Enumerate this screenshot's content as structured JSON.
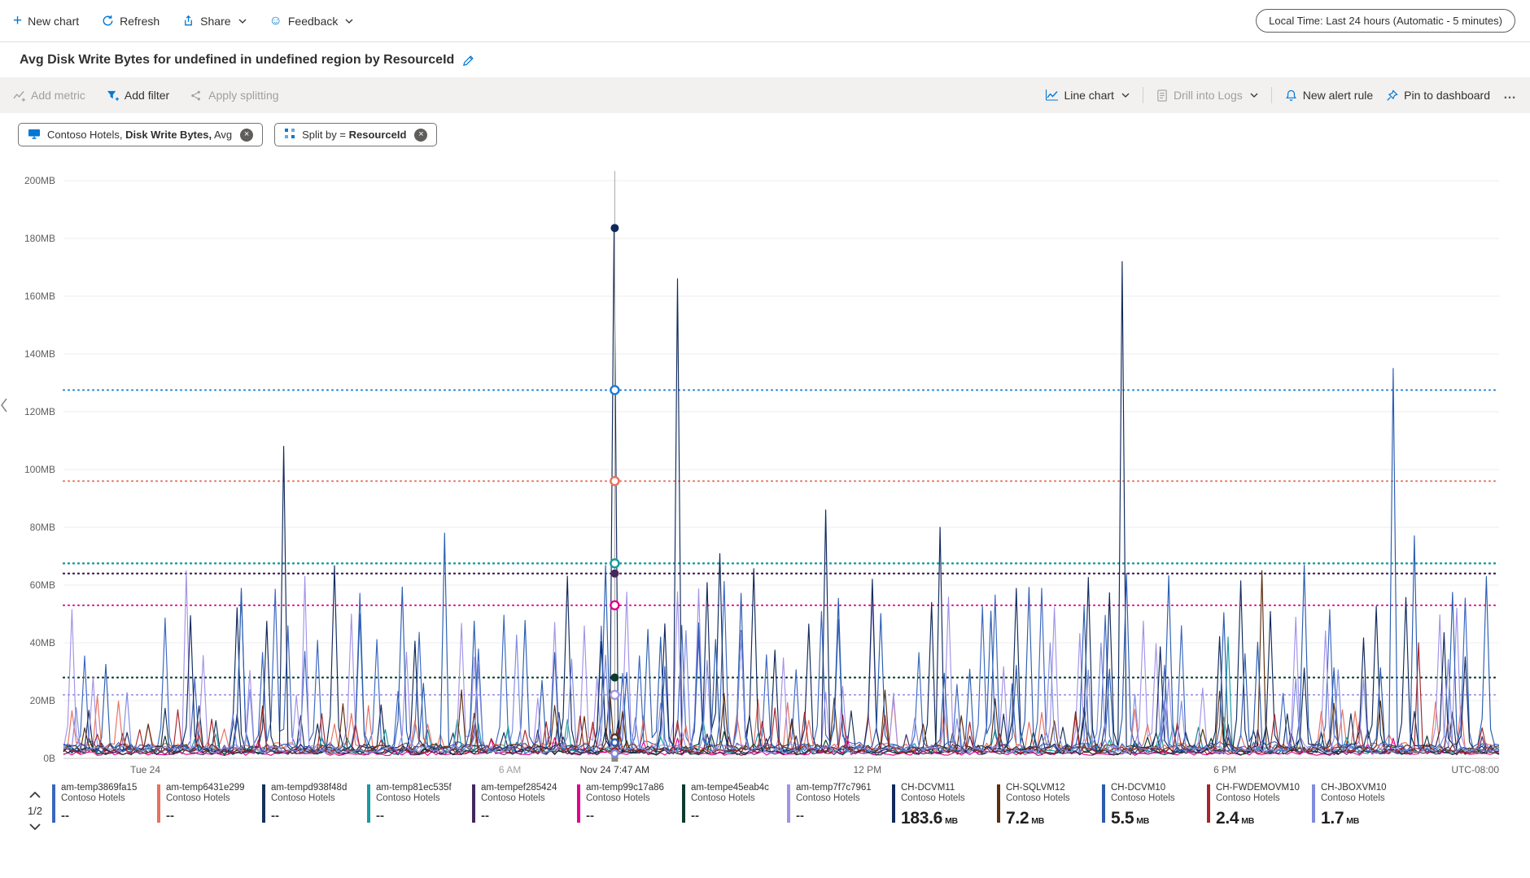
{
  "icons": {
    "plus": "+",
    "close": "×",
    "smiley": "☺"
  },
  "top_toolbar": {
    "new_chart": "New chart",
    "refresh": "Refresh",
    "share": "Share",
    "feedback": "Feedback",
    "time_range": "Local Time: Last 24 hours (Automatic - 5 minutes)"
  },
  "title": "Avg Disk Write Bytes for undefined in undefined region by ResourceId",
  "chart_toolbar": {
    "add_metric": "Add metric",
    "add_filter": "Add filter",
    "apply_splitting": "Apply splitting",
    "line_chart": "Line chart",
    "drill_into_logs": "Drill into Logs",
    "new_alert_rule": "New alert rule",
    "pin_to_dashboard": "Pin to dashboard",
    "more": "…"
  },
  "filters": {
    "metric_pill": {
      "scope": "Contoso Hotels, ",
      "metric": "Disk Write Bytes,",
      "aggregation": " Avg"
    },
    "split_pill": {
      "label": "Split by",
      "operator": " = ",
      "value": "ResourceId"
    }
  },
  "chart": {
    "type": "line",
    "y_max_mb": 200,
    "y_ticks": [
      {
        "label": "200MB",
        "value": 200
      },
      {
        "label": "180MB",
        "value": 180
      },
      {
        "label": "160MB",
        "value": 160
      },
      {
        "label": "140MB",
        "value": 140
      },
      {
        "label": "120MB",
        "value": 120
      },
      {
        "label": "100MB",
        "value": 100
      },
      {
        "label": "80MB",
        "value": 80
      },
      {
        "label": "60MB",
        "value": 60
      },
      {
        "label": "40MB",
        "value": 40
      },
      {
        "label": "20MB",
        "value": 20
      },
      {
        "label": "0B",
        "value": 0
      }
    ],
    "x_ticks": [
      {
        "label": "Tue 24",
        "t": 0.057
      },
      {
        "label": "6 AM",
        "t": 0.311,
        "muted": true
      },
      {
        "label": "Nov 24 7:47 AM",
        "t": 0.384,
        "emph": true
      },
      {
        "label": "12 PM",
        "t": 0.56
      },
      {
        "label": "6 PM",
        "t": 0.809
      },
      {
        "label": "UTC-08:00",
        "t": 1,
        "end": true
      }
    ],
    "crosshair": {
      "t": 0.384,
      "label": "Nov 24 7:47 AM"
    },
    "hover_lines": [
      {
        "color": "#1d7dd7",
        "value_mb": 127.5,
        "width": 2
      },
      {
        "color": "#e8705f",
        "value_mb": 96,
        "width": 2
      },
      {
        "color": "#159ba0",
        "value_mb": 67.5,
        "width": 2.4
      },
      {
        "color": "#45275e",
        "value_mb": 64,
        "width": 2.4
      },
      {
        "color": "#e3008c",
        "value_mb": 53,
        "width": 2
      },
      {
        "color": "#0c3b2e",
        "value_mb": 28,
        "width": 2.2
      },
      {
        "color": "#a293e8",
        "value_mb": 22,
        "width": 2
      }
    ],
    "crosshair_dots": [
      {
        "color": "#10295c",
        "value_mb": 183.6,
        "filled": true
      },
      {
        "color": "#1d7dd7",
        "value_mb": 127.5,
        "filled": false
      },
      {
        "color": "#e8705f",
        "value_mb": 96,
        "filled": false
      },
      {
        "color": "#159ba0",
        "value_mb": 67.5,
        "filled": false
      },
      {
        "color": "#45275e",
        "value_mb": 64,
        "filled": true
      },
      {
        "color": "#e3008c",
        "value_mb": 53,
        "filled": false
      },
      {
        "color": "#0c3b2e",
        "value_mb": 28,
        "filled": true
      },
      {
        "color": "#a293e8",
        "value_mb": 22,
        "filled": false
      },
      {
        "color": "#5c2e0e",
        "value_mb": 7.2,
        "filled": false
      },
      {
        "color": "#2a5db0",
        "value_mb": 5.5,
        "filled": false
      },
      {
        "color": "#a4262c",
        "value_mb": 2.4,
        "filled": false
      },
      {
        "color": "#7f8ce0",
        "value_mb": 1.7,
        "filled": false
      }
    ],
    "series": [
      {
        "name": "am-temp3869fa15",
        "color": "#3a66c0",
        "seed": 101,
        "base": 2,
        "noise": 4,
        "spike_every": 8,
        "spike_min": 22,
        "spike_max": 65,
        "spikes": []
      },
      {
        "name": "am-temp6431e299",
        "color": "#e8705f",
        "seed": 102,
        "base": 2.5,
        "noise": 3,
        "spike_every": 9,
        "spike_min": 8,
        "spike_max": 22,
        "spikes": []
      },
      {
        "name": "am-tempd938f48d",
        "color": "#16325c",
        "seed": 103,
        "base": 1.5,
        "noise": 2.5,
        "spike_every": 11,
        "spike_min": 8,
        "spike_max": 20,
        "spikes": []
      },
      {
        "name": "am-temp81ec535f",
        "color": "#159ba0",
        "seed": 104,
        "base": 1.5,
        "noise": 2.5,
        "spike_every": 13,
        "spike_min": 5,
        "spike_max": 14,
        "spikes": [
          {
            "t": 0.812,
            "v": 42
          }
        ]
      },
      {
        "name": "am-tempef285424",
        "color": "#45275e",
        "seed": 105,
        "base": 1.2,
        "noise": 2,
        "spike_every": 15,
        "spike_min": 4,
        "spike_max": 10,
        "spikes": []
      },
      {
        "name": "am-temp99c17a86",
        "color": "#e3008c",
        "seed": 106,
        "base": 1,
        "noise": 1.5,
        "spike_every": 17,
        "spike_min": 3,
        "spike_max": 8,
        "spikes": []
      },
      {
        "name": "am-tempe45eab4c",
        "color": "#0c3b2e",
        "seed": 107,
        "base": 1.2,
        "noise": 2,
        "spike_every": 14,
        "spike_min": 4,
        "spike_max": 10,
        "spikes": []
      },
      {
        "name": "am-temp7f7c7961",
        "color": "#a293e8",
        "seed": 108,
        "base": 2,
        "noise": 3,
        "spike_every": 10,
        "spike_min": 15,
        "spike_max": 60,
        "spikes": [
          {
            "t": 0.085,
            "v": 65
          },
          {
            "t": 0.168,
            "v": 63
          }
        ]
      },
      {
        "name": "CH-DCVM11",
        "color": "#10295c",
        "seed": 109,
        "base": 2,
        "noise": 3,
        "spike_every": 9,
        "spike_min": 30,
        "spike_max": 72,
        "spikes": [
          {
            "t": 0.154,
            "v": 108
          },
          {
            "t": 0.384,
            "v": 183.6
          },
          {
            "t": 0.428,
            "v": 166
          },
          {
            "t": 0.532,
            "v": 86
          },
          {
            "t": 0.611,
            "v": 80
          },
          {
            "t": 0.737,
            "v": 172
          }
        ]
      },
      {
        "name": "CH-SQLVM12",
        "color": "#5c2e0e",
        "seed": 110,
        "base": 2,
        "noise": 3,
        "spike_every": 8,
        "spike_min": 10,
        "spike_max": 24,
        "spikes": [
          {
            "t": 0.836,
            "v": 65
          }
        ]
      },
      {
        "name": "CH-DCVM10",
        "color": "#2a5db0",
        "seed": 111,
        "base": 2,
        "noise": 3,
        "spike_every": 9,
        "spike_min": 25,
        "spike_max": 68,
        "spikes": [
          {
            "t": 0.266,
            "v": 78
          },
          {
            "t": 0.925,
            "v": 135
          },
          {
            "t": 0.942,
            "v": 77
          }
        ]
      },
      {
        "name": "CH-FWDEMOVM10",
        "color": "#a4262c",
        "seed": 112,
        "base": 1.5,
        "noise": 2.5,
        "spike_every": 11,
        "spike_min": 6,
        "spike_max": 18,
        "spikes": [
          {
            "t": 0.945,
            "v": 40
          }
        ]
      },
      {
        "name": "CH-JBOXVM10",
        "color": "#7f8ce0",
        "seed": 113,
        "base": 1.8,
        "noise": 2.5,
        "spike_every": 11,
        "spike_min": 12,
        "spike_max": 45,
        "spikes": []
      }
    ]
  },
  "legend": {
    "page": "1/2",
    "items": [
      {
        "name": "am-temp3869fa15",
        "company": "Contoso Hotels",
        "color": "#3a66c0",
        "value": "--",
        "unit": ""
      },
      {
        "name": "am-temp6431e299",
        "company": "Contoso Hotels",
        "color": "#e8705f",
        "value": "--",
        "unit": ""
      },
      {
        "name": "am-tempd938f48d",
        "company": "Contoso Hotels",
        "color": "#16325c",
        "value": "--",
        "unit": ""
      },
      {
        "name": "am-temp81ec535f",
        "company": "Contoso Hotels",
        "color": "#159ba0",
        "value": "--",
        "unit": ""
      },
      {
        "name": "am-tempef285424",
        "company": "Contoso Hotels",
        "color": "#45275e",
        "value": "--",
        "unit": ""
      },
      {
        "name": "am-temp99c17a86",
        "company": "Contoso Hotels",
        "color": "#e3008c",
        "value": "--",
        "unit": ""
      },
      {
        "name": "am-tempe45eab4c",
        "company": "Contoso Hotels",
        "color": "#0c3b2e",
        "value": "--",
        "unit": ""
      },
      {
        "name": "am-temp7f7c7961",
        "company": "Contoso Hotels",
        "color": "#a293e8",
        "value": "--",
        "unit": ""
      },
      {
        "name": "CH-DCVM11",
        "company": "Contoso Hotels",
        "color": "#10295c",
        "value": "183.6",
        "unit": "MB"
      },
      {
        "name": "CH-SQLVM12",
        "company": "Contoso Hotels",
        "color": "#5c2e0e",
        "value": "7.2",
        "unit": "MB"
      },
      {
        "name": "CH-DCVM10",
        "company": "Contoso Hotels",
        "color": "#2a5db0",
        "value": "5.5",
        "unit": "MB"
      },
      {
        "name": "CH-FWDEMOVM10",
        "company": "Contoso Hotels",
        "color": "#a4262c",
        "value": "2.4",
        "unit": "MB"
      },
      {
        "name": "CH-JBOXVM10",
        "company": "Contoso Hotels",
        "color": "#7f8ce0",
        "value": "1.7",
        "unit": "MB"
      }
    ]
  }
}
